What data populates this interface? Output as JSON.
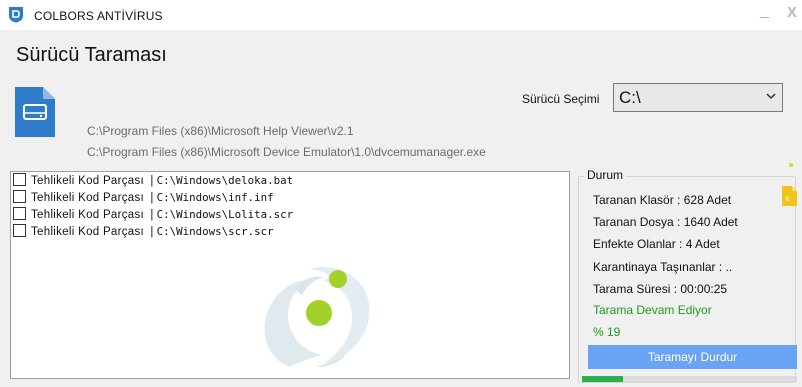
{
  "window": {
    "title": "COLBORS ANTİVİRUS",
    "minimize_glyph": "_",
    "close_glyph": "X"
  },
  "page": {
    "title": "Sürücü Taraması"
  },
  "scan": {
    "path_lines": [
      "C:\\Program Files (x86)\\Microsoft Help Viewer\\v2.1",
      "C:\\Program Files (x86)\\Microsoft Device Emulator\\1.0\\dvcemumanager.exe"
    ]
  },
  "drive": {
    "label": "Sürücü Seçimi",
    "selected": "C:\\"
  },
  "results": [
    {
      "category": "Tehlikeli Kod Parçası",
      "path": "C:\\Windows\\deloka.bat",
      "checked": false
    },
    {
      "category": "Tehlikeli Kod Parçası",
      "path": "C:\\Windows\\inf.inf",
      "checked": false
    },
    {
      "category": "Tehlikeli Kod Parçası",
      "path": "C:\\Windows\\Lolita.scr",
      "checked": false
    },
    {
      "category": "Tehlikeli Kod Parçası",
      "path": "C:\\Windows\\scr.scr",
      "checked": false
    }
  ],
  "status": {
    "group_title": "Durum",
    "scanned_folders": "Taranan Klasör : 628 Adet",
    "scanned_files": "Taranan Dosya : 1640 Adet",
    "infected": "Enfekte Olanlar : 4 Adet",
    "quarantined": "Karantinaya Taşınanlar : ..",
    "duration": "Tarama Süresi : 00:00:25",
    "state": "Tarama Devam Ediyor",
    "percent_text": "% 19",
    "stop_button": "Taramayı Durdur",
    "progress": 0.19
  },
  "colors": {
    "accent": "#6aa3f4",
    "success": "#1f9a1f",
    "progress_fill": "#27b14a",
    "drive_icon": "#2e7bc9",
    "watermark_green": "#a3d12a"
  },
  "icons": [
    "shield-icon",
    "drive-icon",
    "chevron-down-icon",
    "file-icon",
    "dragon-watermark"
  ]
}
